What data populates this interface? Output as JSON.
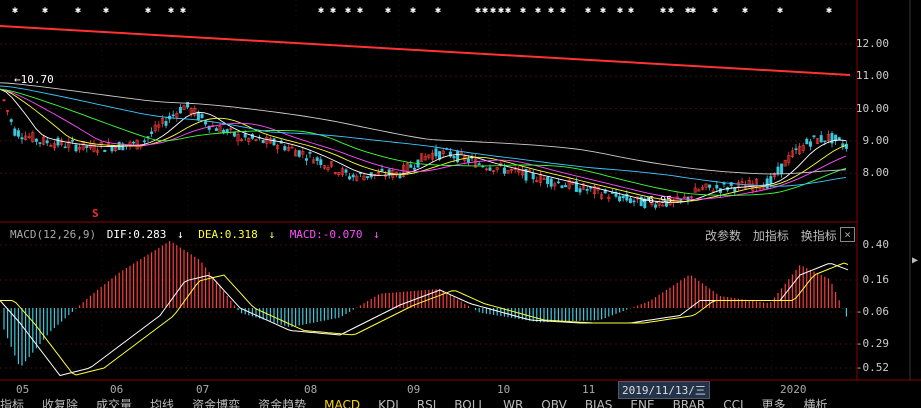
{
  "price_axis": [
    "12.00",
    "11.00",
    "10.00",
    "9.00",
    "8.00"
  ],
  "macd_axis": [
    "0.40",
    "0.16",
    "-0.06",
    "-0.29",
    "-0.52"
  ],
  "x_axis": [
    "05",
    "06",
    "07",
    "08",
    "09",
    "10",
    "11",
    "2020"
  ],
  "crosshair_date": "2019/11/13/三",
  "high_label": "10.70",
  "low_label": "6.95",
  "signal_mark": "S",
  "macd": {
    "title": "MACD(12,26,9)",
    "dif_label": "DIF:0.283",
    "dif_arrow": "↓",
    "dea_label": "DEA:0.318",
    "dea_arrow": "↓",
    "macd_label": "MACD:-0.070",
    "macd_arrow": "↓"
  },
  "tools": {
    "params": "改参数",
    "add": "加指标",
    "switch": "换指标",
    "close": "×"
  },
  "tabs": [
    "指标",
    "收复除",
    "成交量",
    "均线",
    "资金博弈",
    "资金趋势",
    "MACD",
    "KDJ",
    "RSI",
    "BOLL",
    "WR",
    "OBV",
    "BIAS",
    "ENE",
    "BRAR",
    "CCI",
    "更多",
    "横析"
  ],
  "active_tab": "MACD",
  "colors": {
    "up": "#ff3c3c",
    "down": "#3cc8dc",
    "dif": "#ffffff",
    "dea": "#ffff3c",
    "macd_text": "#ff4cff",
    "trend": "#ff3333"
  },
  "chart_data": [
    {
      "type": "line",
      "title": "",
      "yrange": [
        7.4,
        12.6
      ],
      "x": [
        "05",
        "06",
        "07",
        "08",
        "09",
        "10",
        "11",
        "2020"
      ],
      "series": [
        {
          "values": [
            10.5,
            9.0,
            9.9,
            8.0,
            8.7,
            7.9,
            7.3,
            8.7
          ]
        }
      ]
    },
    {
      "type": "bar",
      "title": "MACD(12,26,9)",
      "yrange": [
        -0.56,
        0.48
      ],
      "x": [
        "05",
        "06",
        "07",
        "08",
        "09",
        "10",
        "11",
        "2020"
      ],
      "series": [
        {
          "name": "DIF",
          "values": [
            0.0,
            -0.45,
            0.22,
            -0.2,
            0.1,
            -0.1,
            -0.15,
            0.38
          ]
        },
        {
          "name": "DEA",
          "values": [
            0.0,
            -0.4,
            0.15,
            -0.15,
            0.05,
            -0.05,
            -0.1,
            0.32
          ]
        }
      ]
    }
  ]
}
